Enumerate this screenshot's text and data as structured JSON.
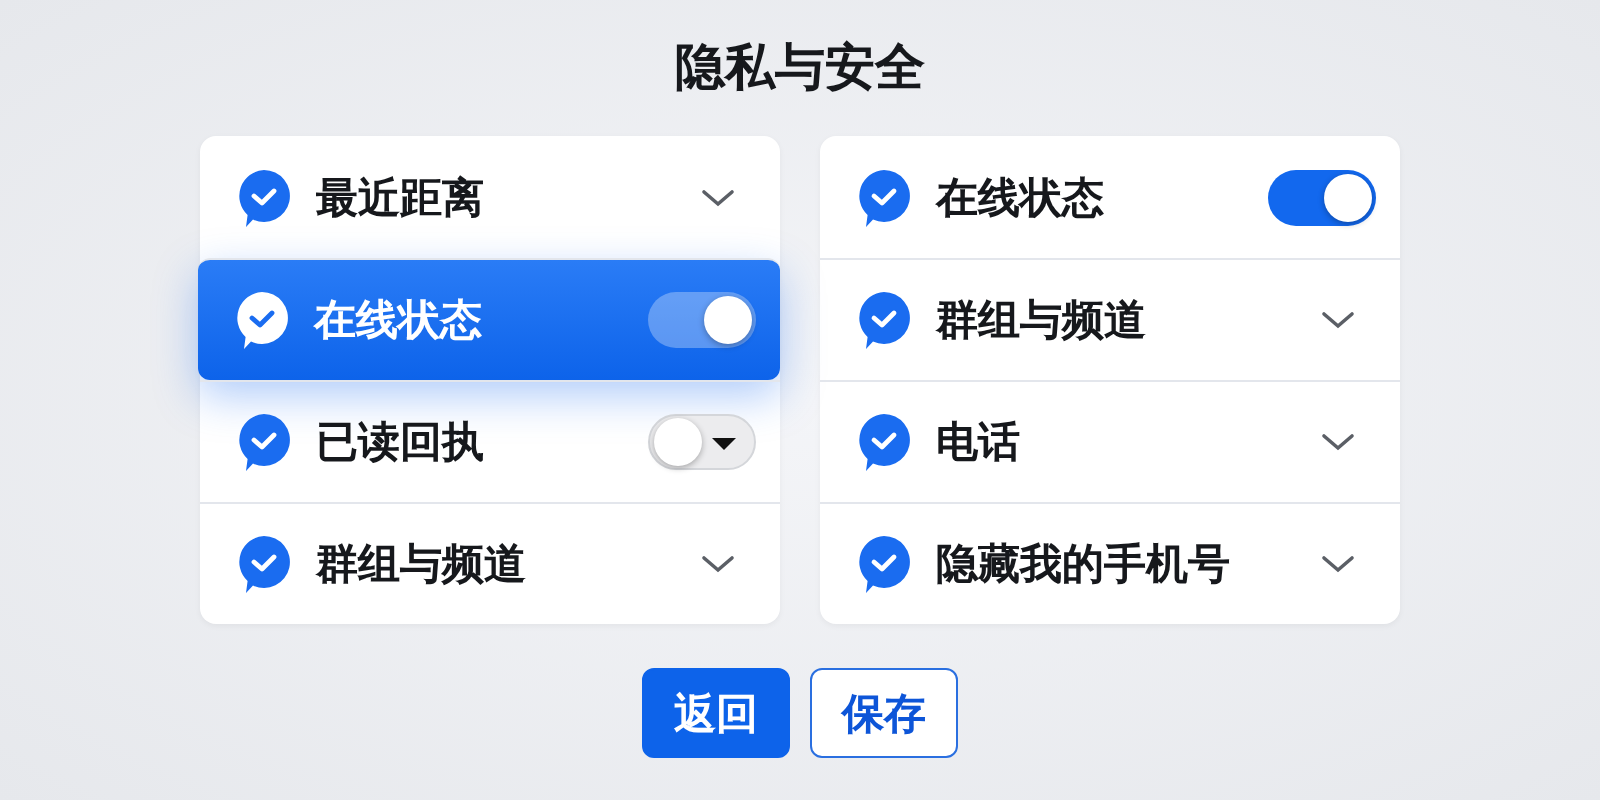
{
  "title": "隐私与安全",
  "columns": [
    {
      "items": [
        {
          "label": "最近距离",
          "kind": "dropdown",
          "selected": false
        },
        {
          "label": "在线状态",
          "kind": "toggle",
          "on": true,
          "selected": true
        },
        {
          "label": "已读回执",
          "kind": "toggle-menu",
          "on": false,
          "selected": false
        },
        {
          "label": "群组与频道",
          "kind": "dropdown",
          "selected": false
        }
      ]
    },
    {
      "items": [
        {
          "label": "在线状态",
          "kind": "toggle",
          "on": true,
          "selected": false
        },
        {
          "label": "群组与频道",
          "kind": "dropdown",
          "selected": false
        },
        {
          "label": "电话",
          "kind": "dropdown",
          "selected": false
        },
        {
          "label": "隐藏我的手机号",
          "kind": "dropdown",
          "selected": false
        }
      ]
    }
  ],
  "buttons": [
    {
      "label": "返回",
      "kind": "primary"
    },
    {
      "label": "保存",
      "kind": "secondary"
    }
  ]
}
